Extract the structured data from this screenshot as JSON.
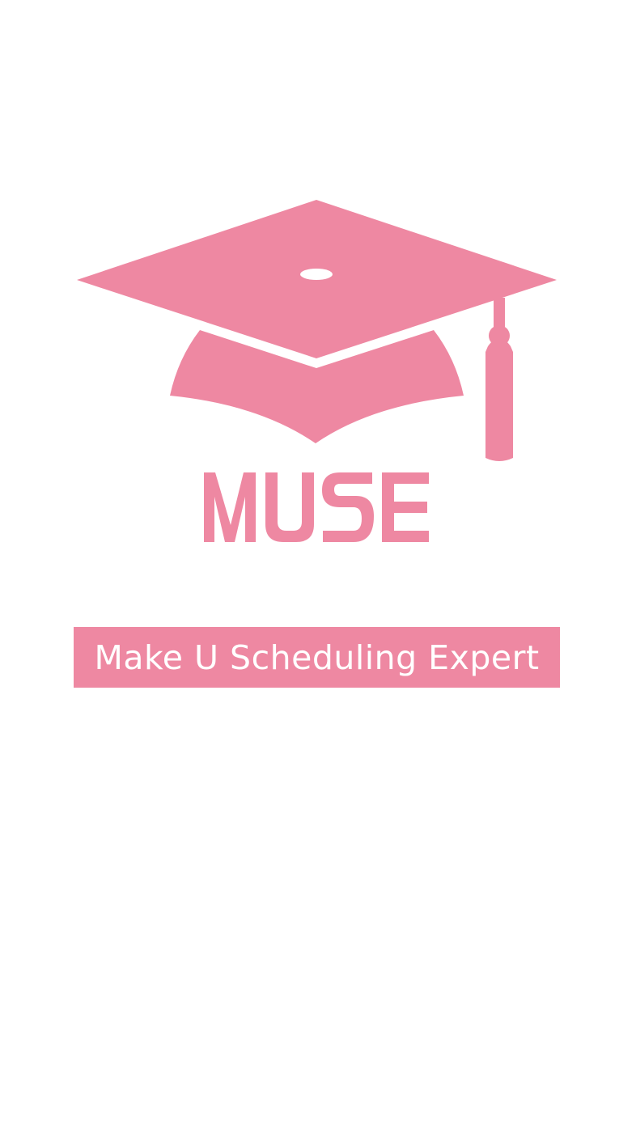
{
  "app": {
    "logo_icon": "graduation-cap-icon",
    "wordmark": "MUSE",
    "tagline": "Make U Scheduling Expert"
  },
  "colors": {
    "brand_pink": "#ee88a2",
    "background": "#ffffff",
    "tagline_text": "#ffffff"
  }
}
